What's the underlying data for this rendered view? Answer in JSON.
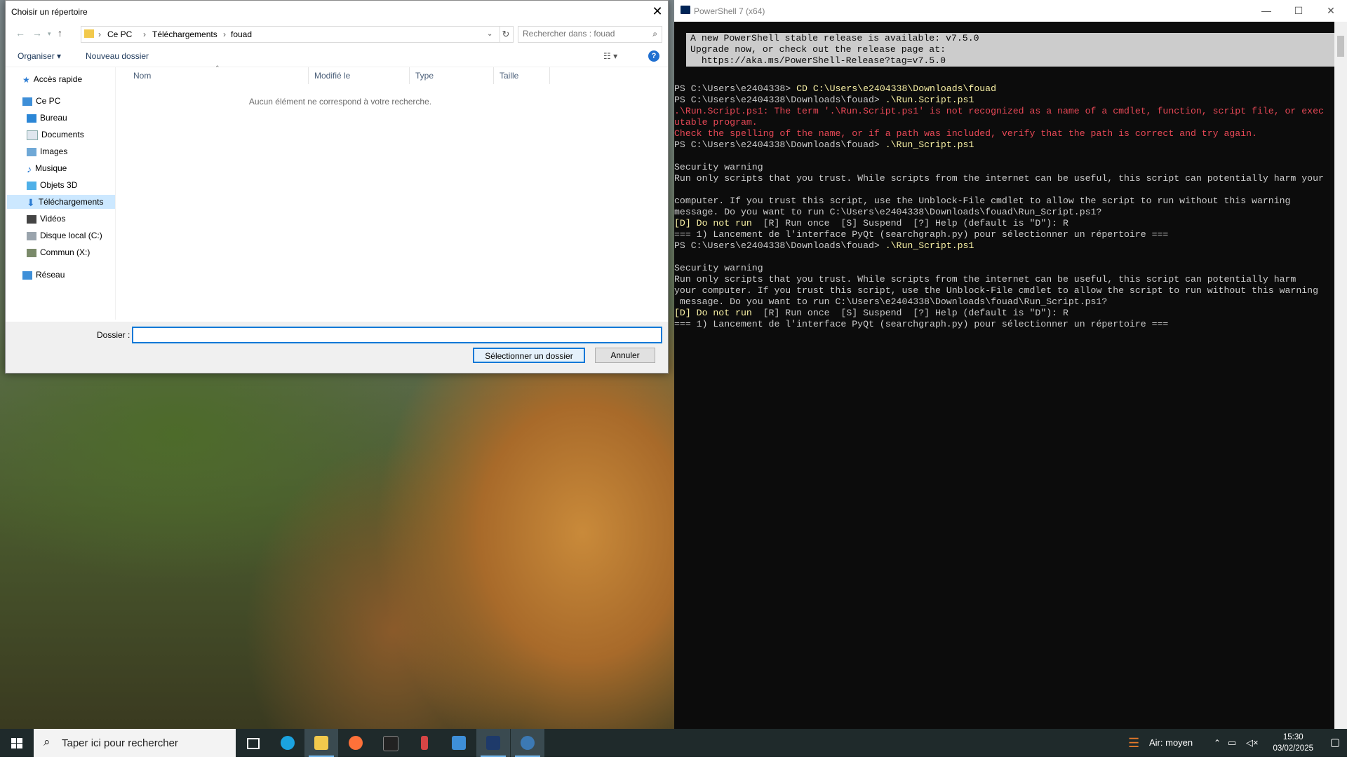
{
  "dialog": {
    "title": "Choisir un répertoire",
    "close_glyph": "✕",
    "breadcrumb": [
      "Ce PC",
      "Téléchargements",
      "fouad"
    ],
    "search_placeholder": "Rechercher dans : fouad",
    "toolbar": {
      "organize": "Organiser ▾",
      "new_folder": "Nouveau dossier",
      "help": "?"
    },
    "nav": {
      "quick_access": "Accès rapide",
      "this_pc": "Ce PC",
      "items": [
        "Bureau",
        "Documents",
        "Images",
        "Musique",
        "Objets 3D",
        "Téléchargements",
        "Vidéos",
        "Disque local (C:)",
        "Commun (X:)"
      ],
      "network": "Réseau",
      "selected": "Téléchargements"
    },
    "columns": [
      "Nom",
      "Modifié le",
      "Type",
      "Taille"
    ],
    "empty_message": "Aucun élément ne correspond à votre recherche.",
    "folder_label": "Dossier :",
    "folder_value": "",
    "select_button": "Sélectionner un dossier",
    "cancel_button": "Annuler"
  },
  "powershell": {
    "title": "PowerShell 7 (x64)",
    "controls": {
      "minimize": "—",
      "maximize": "☐",
      "close": "✕"
    },
    "banner": [
      "A new PowerShell stable release is available: v7.5.0",
      "Upgrade now, or check out the release page at:",
      "  https://aka.ms/PowerShell-Release?tag=v7.5.0"
    ],
    "lines": [
      {
        "t": "PS C:\\Users\\e2404338> ",
        "c": "CD C:\\Users\\e2404338\\Downloads\\fouad"
      },
      {
        "t": "PS C:\\Users\\e2404338\\Downloads\\fouad> ",
        "c": ".\\Run.Script.ps1"
      },
      {
        "e": ".\\Run.Script.ps1: The term '.\\Run.Script.ps1' is not recognized as a name of a cmdlet, function, script file, or exec"
      },
      {
        "e": "utable program."
      },
      {
        "e": "Check the spelling of the name, or if a path was included, verify that the path is correct and try again."
      },
      {
        "t": "PS C:\\Users\\e2404338\\Downloads\\fouad> ",
        "c": ".\\Run_Script.ps1"
      },
      {
        "t": ""
      },
      {
        "t": "Security warning"
      },
      {
        "t": "Run only scripts that you trust. While scripts from the internet can be useful, this script can potentially harm your"
      },
      {
        "t": ""
      },
      {
        "t": "computer. If you trust this script, use the Unblock-File cmdlet to allow the script to run without this warning"
      },
      {
        "t": "message. Do you want to run C:\\Users\\e2404338\\Downloads\\fouad\\Run_Script.ps1?"
      },
      {
        "w": "[D] Do not run  ",
        "t": "[R] Run once  [S] Suspend  [?] Help (default is \"D\"): R"
      },
      {
        "t": "=== 1) Lancement de l'interface PyQt (searchgraph.py) pour sélectionner un répertoire ==="
      },
      {
        "t": "PS C:\\Users\\e2404338\\Downloads\\fouad> ",
        "c": ".\\Run_Script.ps1"
      },
      {
        "t": ""
      },
      {
        "t": "Security warning"
      },
      {
        "t": "Run only scripts that you trust. While scripts from the internet can be useful, this script can potentially harm"
      },
      {
        "t": "your computer. If you trust this script, use the Unblock-File cmdlet to allow the script to run without this warning"
      },
      {
        "t": " message. Do you want to run C:\\Users\\e2404338\\Downloads\\fouad\\Run_Script.ps1?"
      },
      {
        "w": "[D] Do not run  ",
        "t": "[R] Run once  [S] Suspend  [?] Help (default is \"D\"): R"
      },
      {
        "t": "=== 1) Lancement de l'interface PyQt (searchgraph.py) pour sélectionner un répertoire ==="
      }
    ]
  },
  "taskbar": {
    "search_placeholder": "Taper ici pour rechercher",
    "apps": [
      "task-view-icon",
      "edge-icon",
      "file-explorer-icon",
      "firefox-icon",
      "terminal-icon",
      "app-red-icon",
      "vscode-icon",
      "powershell-icon",
      "python-icon"
    ],
    "weather": "Air: moyen",
    "time": "15:30",
    "date": "03/02/2025"
  }
}
